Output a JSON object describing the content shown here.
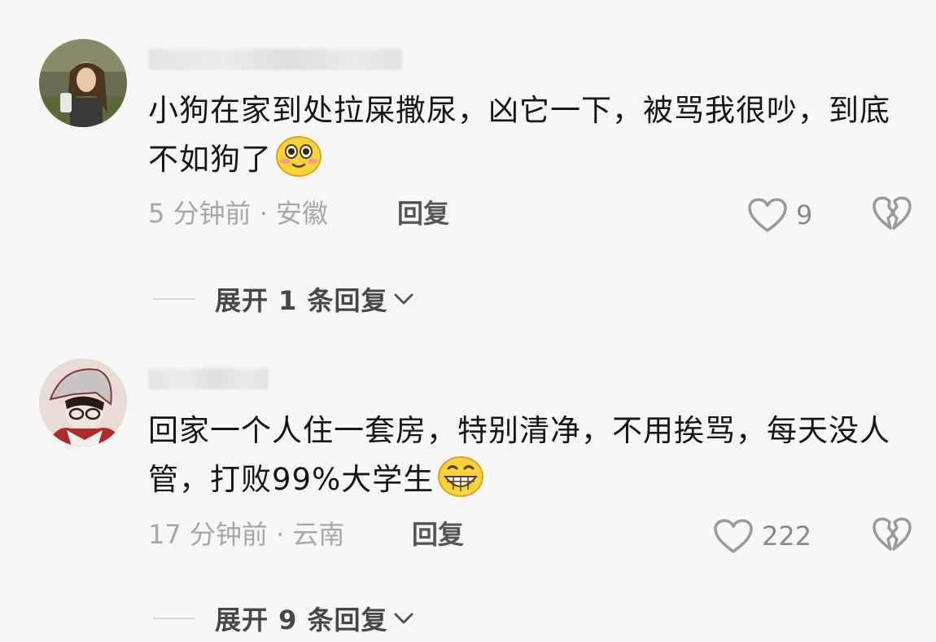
{
  "comments": [
    {
      "text": "小狗在家到处拉屎撒尿，凶它一下，被骂我很吵，到底不如狗了",
      "emoji": "blushing-smile-emoji",
      "time_location": "5 分钟前 · 安徽",
      "reply_label": "回复",
      "likes": "9",
      "expand_label": "展开 1 条回复"
    },
    {
      "text": "回家一个人住一套房，特别清净，不用挨骂，每天没人管，打败99%大学生",
      "emoji": "grinning-teeth-emoji",
      "time_location": "17 分钟前 · 云南",
      "reply_label": "回复",
      "likes": "222",
      "expand_label": "展开 9 条回复"
    }
  ],
  "colors": {
    "background": "#f7f7f7",
    "text": "#161616",
    "meta": "#a7a7a7",
    "icon": "#9a9a9a"
  },
  "icons": [
    "heart-icon",
    "broken-heart-icon",
    "chevron-down-icon"
  ]
}
